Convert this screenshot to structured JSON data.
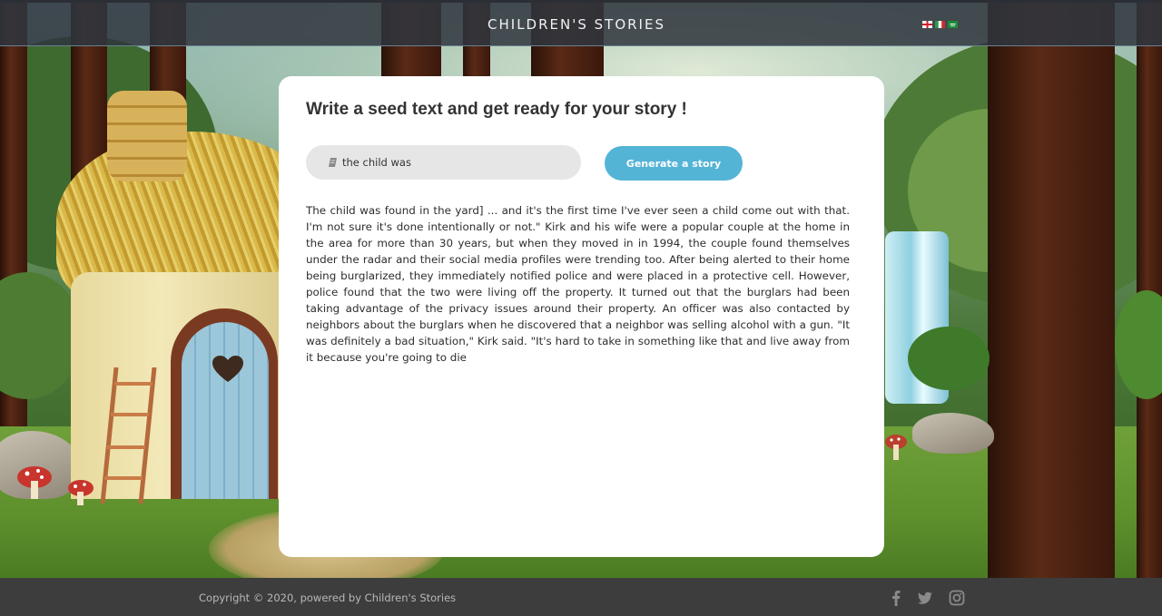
{
  "header": {
    "brand": "CHILDREN'S STORIES",
    "flags": [
      "england-flag",
      "italy-flag",
      "saudi-arabia-flag"
    ]
  },
  "form": {
    "title": "Write a seed text and get ready for your story !",
    "seed_value": "the child was",
    "generate_label": "Generate a story"
  },
  "story": {
    "text": "The child was found in the yard] ... and it's the first time I've ever seen a child come out with that. I'm not sure it's done intentionally or not.\" Kirk and his wife were a popular couple at the home in the area for more than 30 years, but when they moved in in 1994, the couple found themselves under the radar and their social media profiles were trending too. After being alerted to their home being burglarized, they immediately notified police and were placed in a protective cell. However, police found that the two were living off the property. It turned out that the burglars had been taking advantage of the privacy issues around their property. An officer was also contacted by neighbors about the burglars when he discovered that a neighbor was selling alcohol with a gun. \"It was definitely a bad situation,\" Kirk said. \"It's hard to take in something like that and live away from it because you're going to die"
  },
  "footer": {
    "copyright": "Copyright © 2020, powered by Children's Stories",
    "social_icons": [
      "facebook-icon",
      "twitter-icon",
      "instagram-icon"
    ]
  },
  "colors": {
    "header_bg": "#30363e",
    "button": "#54b4d6",
    "input_bg": "#e6e6e6",
    "card_bg": "#ffffff",
    "footer_bg": "#3d3d3d"
  }
}
